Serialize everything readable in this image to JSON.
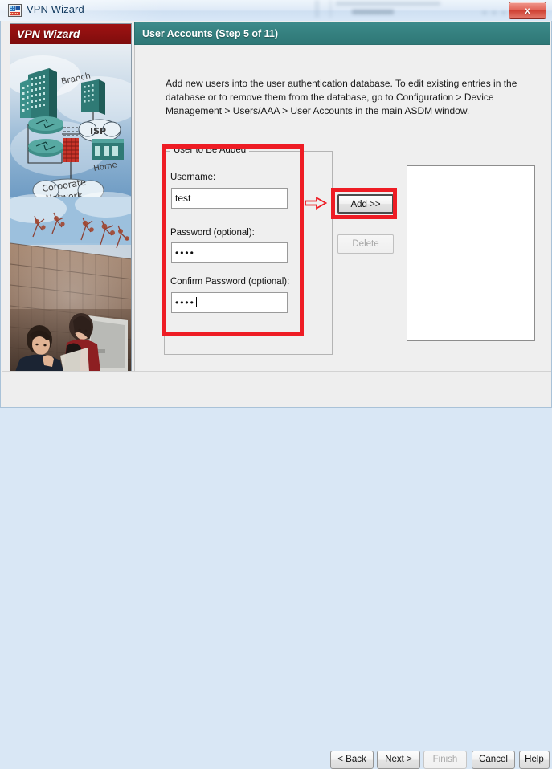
{
  "window": {
    "title": "VPN Wizard",
    "icon": "application-icon",
    "close_label": "x"
  },
  "banner": {
    "title": "VPN Wizard",
    "art_labels": {
      "branch": "Branch",
      "isp": "ISP",
      "home": "Home",
      "corporate": "Corporate",
      "network": "Network"
    }
  },
  "header": {
    "step_title": "User Accounts  (Step 5 of 11)"
  },
  "content": {
    "description": "Add new users into the user authentication database. To edit existing entries in the database or to remove them from the database, go to Configuration > Device Management > Users/AAA > User Accounts in the main ASDM window.",
    "group": {
      "legend": "User to Be Added",
      "username_label": "Username:",
      "username_value": "test",
      "password_label": "Password (optional):",
      "password_value": "••••",
      "confirm_label": "Confirm Password (optional):",
      "confirm_value": "••••"
    },
    "actions": {
      "add_label": "Add >>",
      "delete_label": "Delete"
    },
    "user_list": {
      "items": []
    }
  },
  "footer": {
    "back_label": "< Back",
    "next_label": "Next >",
    "finish_label": "Finish",
    "cancel_label": "Cancel",
    "help_label": "Help"
  },
  "annotations": {
    "accent_color": "#ee1c24",
    "form_highlight": "red-rectangle-around-user-form",
    "add_highlight": "red-rectangle-around-add-button",
    "arrow": "red-arrow-pointing-right"
  },
  "colors": {
    "header_teal": "#35807f",
    "banner_red": "#8d0f0f",
    "close_red": "#cf3f32"
  }
}
